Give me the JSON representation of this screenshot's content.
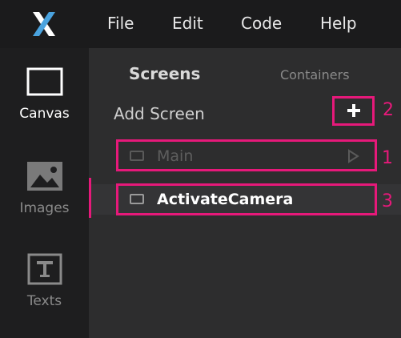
{
  "menu": {
    "file": "File",
    "edit": "Edit",
    "code": "Code",
    "help": "Help"
  },
  "sidebar": {
    "canvas": "Canvas",
    "images": "Images",
    "texts": "Texts"
  },
  "panel": {
    "tab_screens": "Screens",
    "tab_containers": "Containers",
    "add_screen_label": "Add Screen",
    "screens": [
      {
        "name": "Main",
        "state": "disabled"
      },
      {
        "name": "ActivateCamera",
        "state": "selected"
      }
    ]
  },
  "annotations": [
    "1",
    "2",
    "3"
  ],
  "colors": {
    "accent": "#e6197a",
    "logo": "#4aa3df"
  }
}
